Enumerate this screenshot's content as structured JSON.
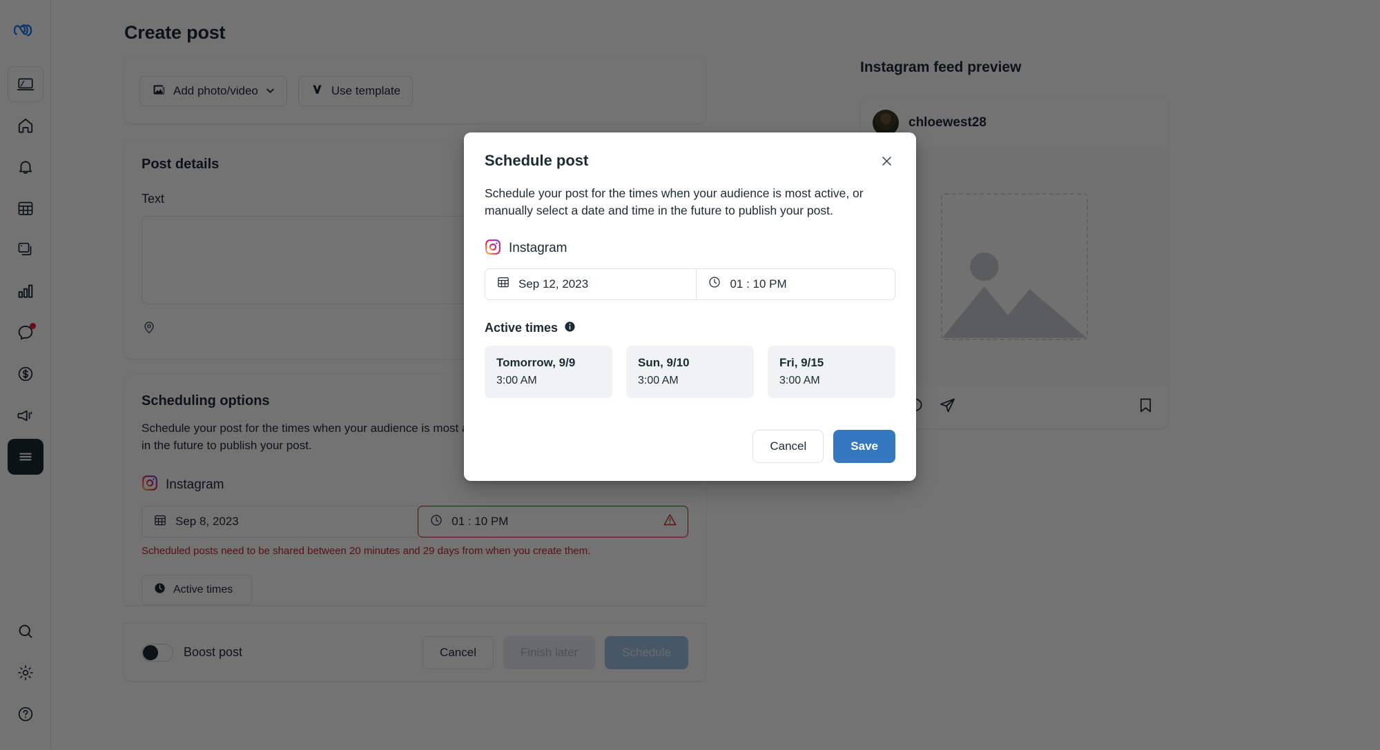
{
  "app": {
    "page_title": "Create post",
    "brand_blue": "#1877f2",
    "accent_blue": "#3578c0",
    "error_red": "#bc2b25"
  },
  "sidebar": {
    "items": [
      {
        "name": "meta-logo",
        "label": "Meta"
      },
      {
        "name": "business-suite",
        "label": "Business suite"
      },
      {
        "name": "home",
        "label": "Home"
      },
      {
        "name": "notifications",
        "label": "Notifications"
      },
      {
        "name": "planner",
        "label": "Planner"
      },
      {
        "name": "content",
        "label": "Content"
      },
      {
        "name": "insights",
        "label": "Insights"
      },
      {
        "name": "inbox",
        "label": "Inbox"
      },
      {
        "name": "monetization",
        "label": "Monetization"
      },
      {
        "name": "ads",
        "label": "Ads"
      },
      {
        "name": "all-tools",
        "label": "All tools"
      },
      {
        "name": "search",
        "label": "Search"
      },
      {
        "name": "settings",
        "label": "Settings"
      },
      {
        "name": "help",
        "label": "Help"
      }
    ]
  },
  "toolbar": {
    "add_media_label": "Add photo/video",
    "use_template_label": "Use template"
  },
  "post_details": {
    "section_title": "Post details",
    "text_label": "Text",
    "text_value": "",
    "text_placeholder": ""
  },
  "scheduling": {
    "section_title": "Scheduling options",
    "description": "Schedule your post for the times when your audience is most active, or manually select a date and time in the future to publish your post.",
    "platform_label": "Instagram",
    "date_value": "Sep 8, 2023",
    "time_value": "01 : 10 PM",
    "error_message": "Scheduled posts need to be shared between 20 minutes and 29 days from when you create them.",
    "active_times_button": "Active times"
  },
  "footer": {
    "boost_label": "Boost post",
    "cancel_label": "Cancel",
    "finish_later_label": "Finish later",
    "schedule_label": "Schedule"
  },
  "preview": {
    "title": "Instagram feed preview",
    "username": "chloewest28"
  },
  "modal": {
    "title": "Schedule post",
    "description": "Schedule your post for the times when your audience is most active, or manually select a date and time in the future to publish your post.",
    "platform_label": "Instagram",
    "date_value": "Sep 12, 2023",
    "time_value": "01 : 10 PM",
    "active_times_title": "Active times",
    "active_times": [
      {
        "day": "Tomorrow, 9/9",
        "time": "3:00 AM"
      },
      {
        "day": "Sun, 9/10",
        "time": "3:00 AM"
      },
      {
        "day": "Fri, 9/15",
        "time": "3:00 AM"
      }
    ],
    "cancel_label": "Cancel",
    "save_label": "Save"
  }
}
